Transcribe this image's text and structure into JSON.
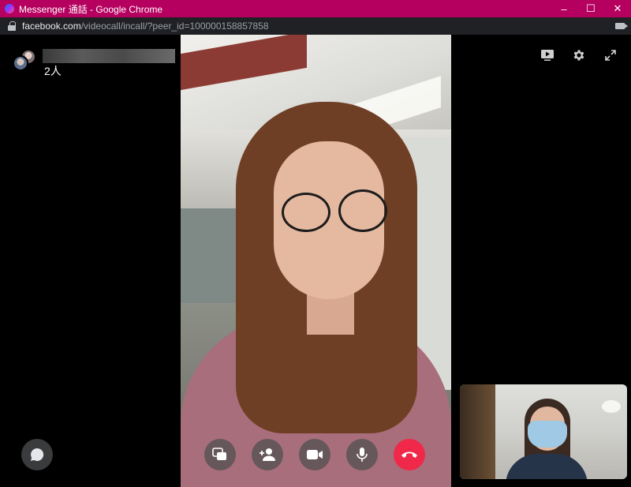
{
  "window": {
    "title": "Messenger 通話 - Google Chrome",
    "buttons": [
      "minimize",
      "maximize",
      "close"
    ],
    "accent_color": "#b5005f"
  },
  "browser": {
    "url_domain": "facebook.com",
    "url_path": "/videocall/incall/?peer_id=100000158857858"
  },
  "call": {
    "participant_count": "2人",
    "top_tools": [
      "screen-share-view-icon",
      "gear-icon",
      "expand-icon"
    ],
    "controls": [
      "share-screen-button",
      "add-person-button",
      "camera-button",
      "microphone-button",
      "end-call-button"
    ],
    "end_call_color": "#f02849"
  }
}
